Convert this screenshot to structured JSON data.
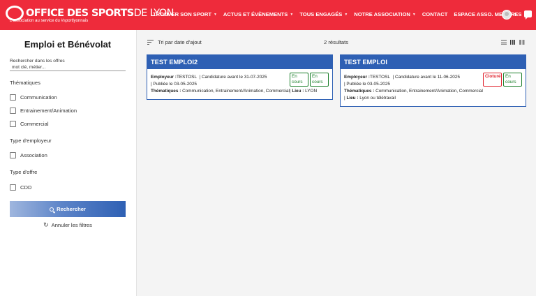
{
  "header": {
    "logo_main": "OFFICE DES SPORTS",
    "logo_light": "DE LYON",
    "tagline": "L'association au service du #sportlyonnais",
    "nav": [
      {
        "label": "TROUVER SON SPORT",
        "dropdown": true
      },
      {
        "label": "ACTUS ET ÉVÈNEMENTS",
        "dropdown": true
      },
      {
        "label": "TOUS ENGAGÉS",
        "dropdown": true
      },
      {
        "label": "NOTRE ASSOCIATION",
        "dropdown": true
      },
      {
        "label": "CONTACT",
        "dropdown": false
      },
      {
        "label": "ESPACE ASSO. MEMBRES",
        "dropdown": false
      }
    ],
    "brand_color": "#ee2b3b"
  },
  "sidebar": {
    "title": "Emploi et Bénévolat",
    "search_label": "Rechercher dans les offres",
    "search_placeholder": "mot clé, métier...",
    "thematiques_title": "Thématiques",
    "thematiques": [
      "Communication",
      "Entrainement/Animation",
      "Commercial"
    ],
    "employeur_title": "Type d'employeur",
    "employeurs": [
      "Association"
    ],
    "offre_title": "Type d'offre",
    "offres": [
      "CDD"
    ],
    "search_button": "Rechercher",
    "reset_label": "Annuler les filtres",
    "accent_color": "#2e60b4"
  },
  "main": {
    "sort_label": "Tri par date d'ajout",
    "results_label": "2 résultats",
    "cards": [
      {
        "title": "TEST EMPLOI2",
        "employer_label": "Employeur :",
        "employer": "TESTOSL",
        "deadline": "| Candidature avant le 31-07-2025",
        "published": "| Publiée le 03-05-2025",
        "thematiques_label": "Thématiques :",
        "thematiques": "Communication, Entrainement/Animation, Commercial",
        "lieu_label": "Lieu :",
        "lieu": "LYON",
        "badges": [
          {
            "text": "En cours",
            "status": "green"
          },
          {
            "text": "En cours",
            "status": "green"
          }
        ]
      },
      {
        "title": "TEST EMPLOI",
        "employer_label": "Employeur :",
        "employer": "TESTOSL",
        "deadline": "| Candidature avant le 11-06-2025",
        "published": "| Publiée le 03-05-2025",
        "thematiques_label": "Thématiques :",
        "thematiques": "Communication, Entrainement/Animation, Commercial",
        "lieu_label": "Lieu :",
        "lieu": "Lyon ou télétravail",
        "badges": [
          {
            "text": "Cloturé",
            "status": "red"
          },
          {
            "text": "En cours",
            "status": "green"
          }
        ]
      }
    ]
  }
}
